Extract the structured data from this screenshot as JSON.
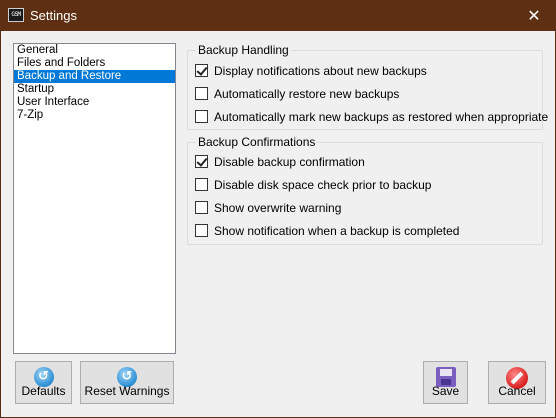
{
  "window": {
    "title": "Settings",
    "app_icon_text": "GSM",
    "close_glyph": "✕"
  },
  "nav": {
    "items": [
      {
        "label": "General",
        "selected": false
      },
      {
        "label": "Files and Folders",
        "selected": false
      },
      {
        "label": "Backup and Restore",
        "selected": true
      },
      {
        "label": "Startup",
        "selected": false
      },
      {
        "label": "User Interface",
        "selected": false
      },
      {
        "label": "7-Zip",
        "selected": false
      }
    ]
  },
  "backup_handling": {
    "title": "Backup Handling",
    "options": [
      {
        "label": "Display notifications about new backups",
        "checked": true
      },
      {
        "label": "Automatically restore new backups",
        "checked": false
      },
      {
        "label": "Automatically mark new backups as restored when appropriate",
        "checked": false
      }
    ]
  },
  "backup_confirmations": {
    "title": "Backup Confirmations",
    "options": [
      {
        "label": "Disable backup confirmation",
        "checked": true
      },
      {
        "label": "Disable disk space check prior to backup",
        "checked": false
      },
      {
        "label": "Show overwrite warning",
        "checked": false
      },
      {
        "label": "Show notification when a backup is completed",
        "checked": false
      }
    ]
  },
  "buttons": {
    "defaults": "Defaults",
    "reset_warnings": "Reset Warnings",
    "save": "Save",
    "cancel": "Cancel"
  },
  "icons": {
    "defaults": "refresh-icon",
    "reset_warnings": "refresh-icon",
    "save": "floppy-disk-icon",
    "cancel": "cancel-icon"
  },
  "colors": {
    "titlebar": "#5e2f12",
    "selection": "#0078d7"
  }
}
